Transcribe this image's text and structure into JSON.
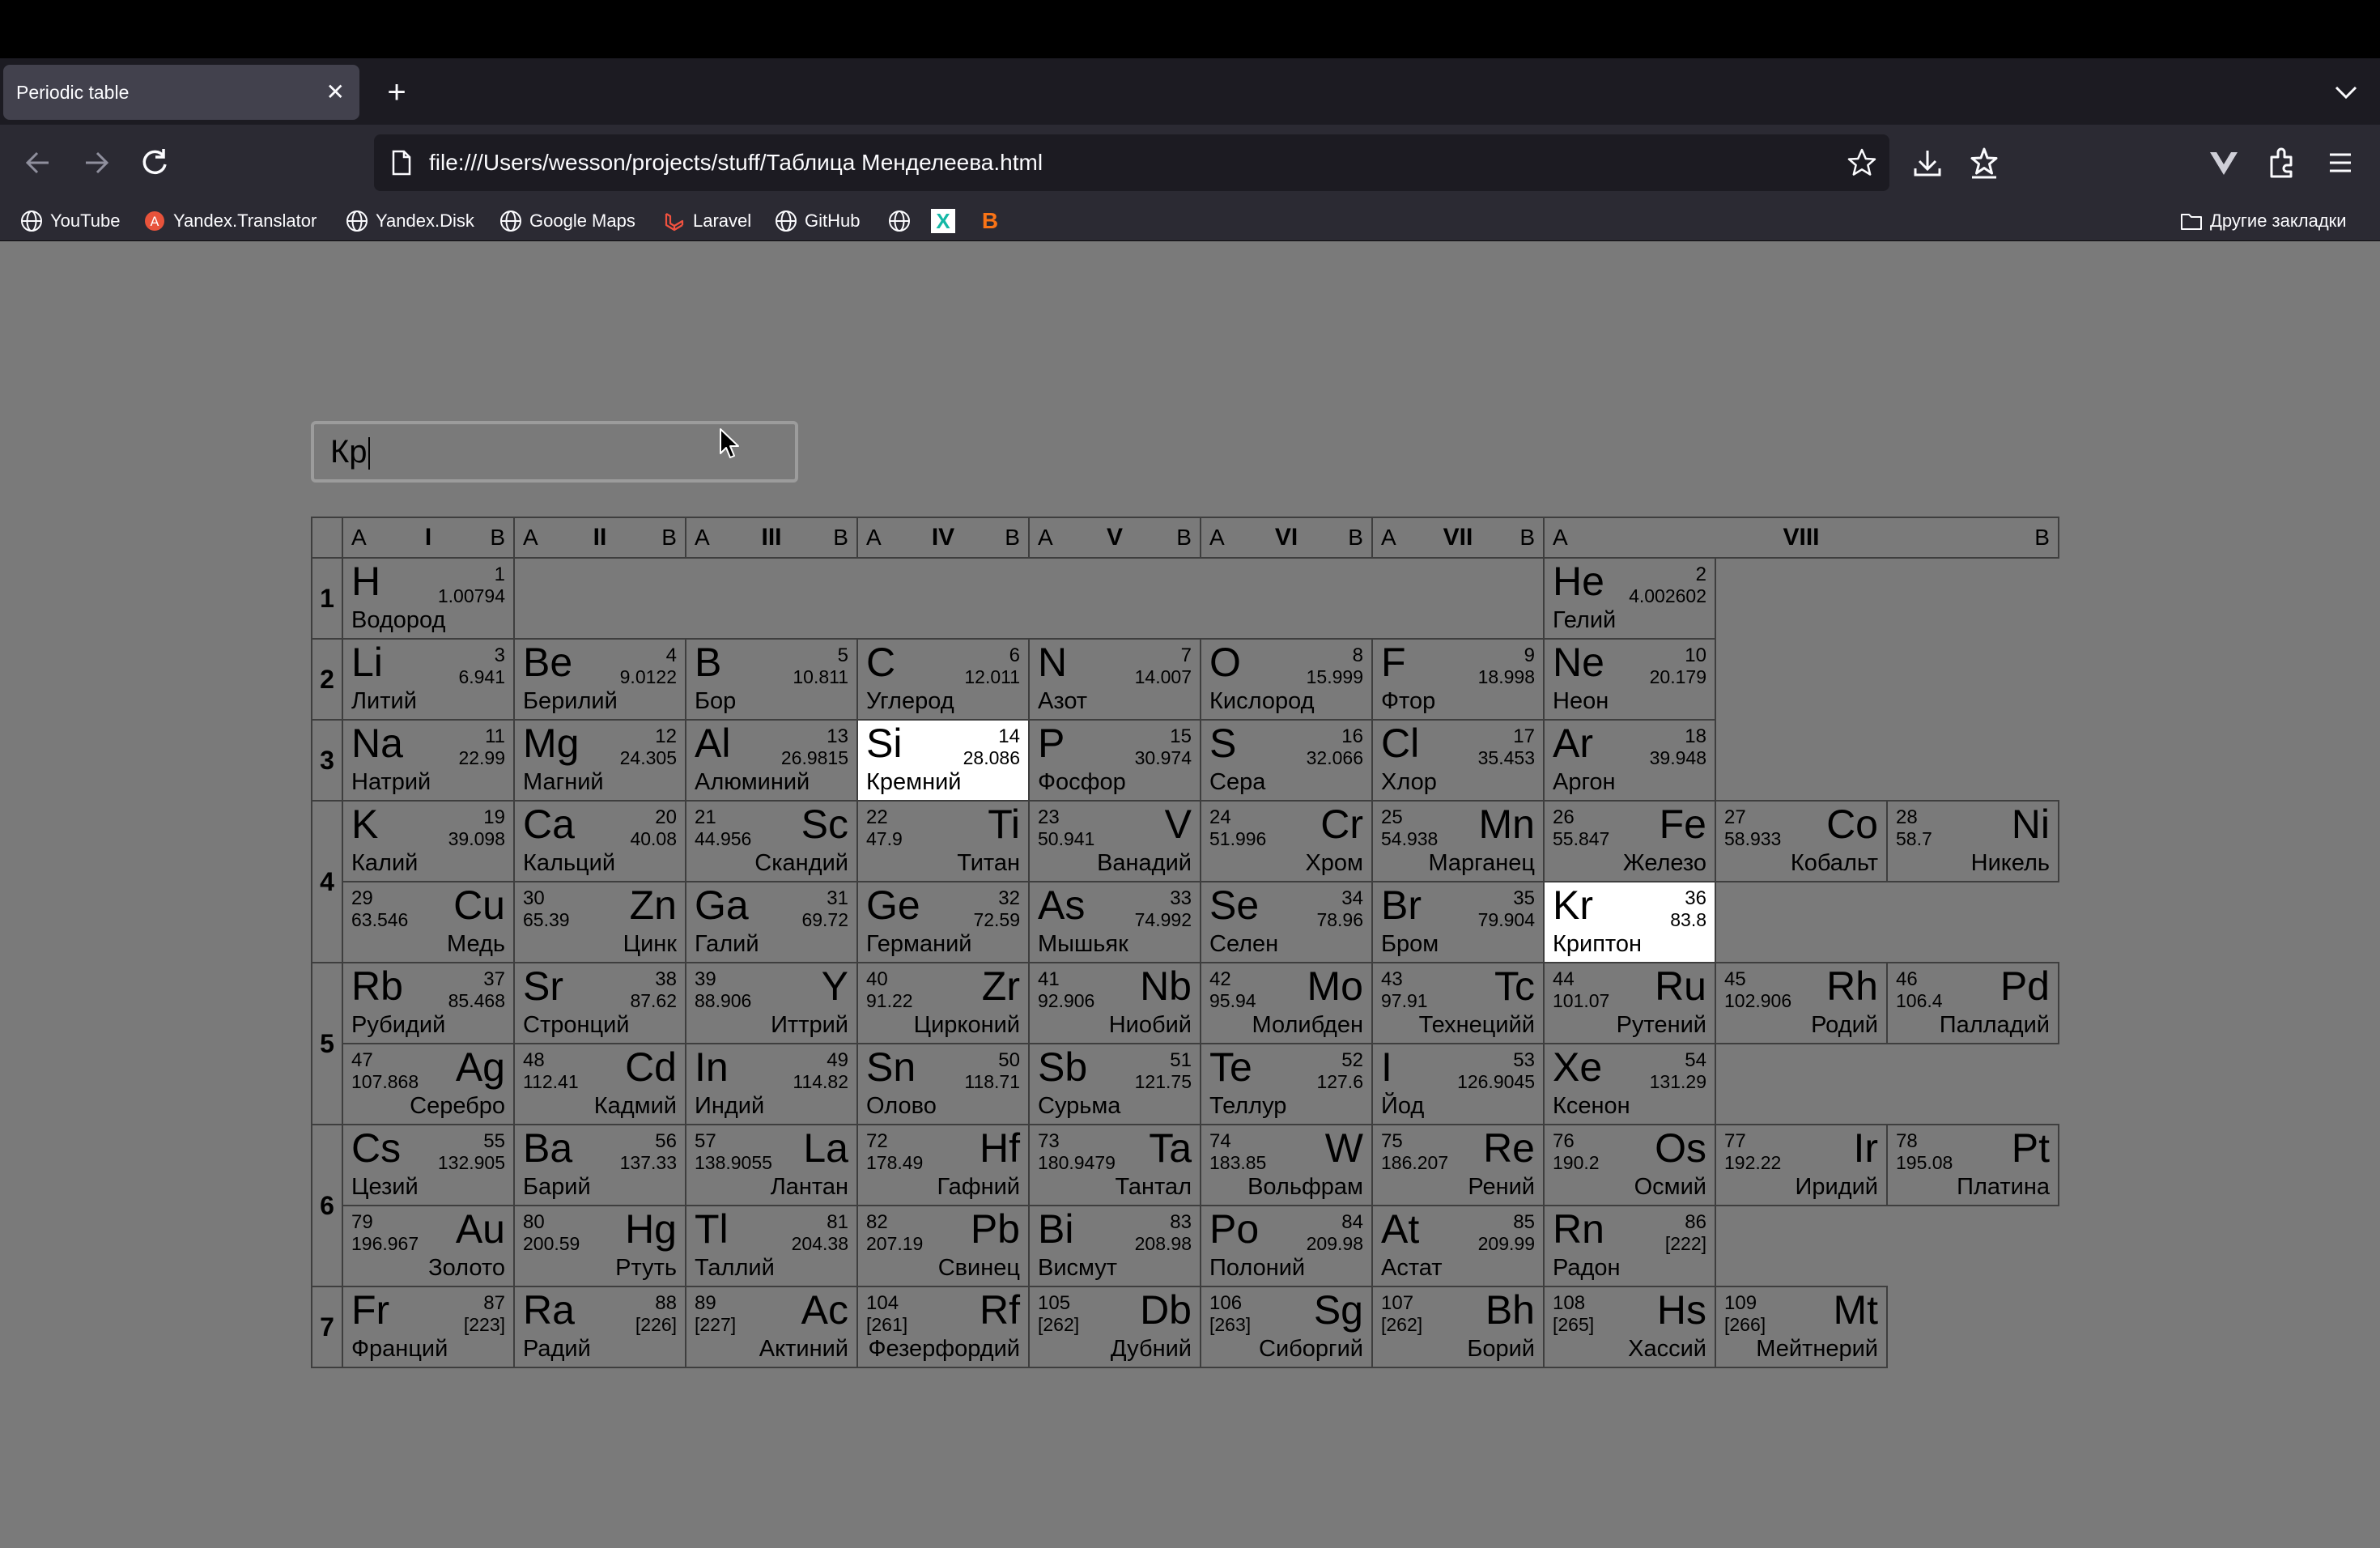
{
  "browser": {
    "tab_title": "Periodic table",
    "url": "file:///Users/wesson/projects/stuff/Таблица Менделеева.html",
    "bookmarks": [
      "YouTube",
      "Yandex.Translator",
      "Yandex.Disk",
      "Google Maps",
      "Laravel",
      "GitHub",
      "",
      "X",
      "B"
    ],
    "other_bookmarks": "Другие закладки"
  },
  "search": {
    "value": "Кр"
  },
  "groups": [
    {
      "a": "A",
      "n": "I",
      "b": "B"
    },
    {
      "a": "A",
      "n": "II",
      "b": "B"
    },
    {
      "a": "A",
      "n": "III",
      "b": "B"
    },
    {
      "a": "A",
      "n": "IV",
      "b": "B"
    },
    {
      "a": "A",
      "n": "V",
      "b": "B"
    },
    {
      "a": "A",
      "n": "VI",
      "b": "B"
    },
    {
      "a": "A",
      "n": "VII",
      "b": "B"
    },
    {
      "a": "A",
      "n": "VIII",
      "b": "B"
    }
  ],
  "periods": [
    {
      "label": "1",
      "rows": 1
    },
    {
      "label": "2",
      "rows": 1
    },
    {
      "label": "3",
      "rows": 1
    },
    {
      "label": "4",
      "rows": 2
    },
    {
      "label": "5",
      "rows": 2
    },
    {
      "label": "6",
      "rows": 2
    },
    {
      "label": "7",
      "rows": 1
    }
  ],
  "rows": [
    [
      [
        "H",
        "1",
        "1.00794",
        "Водород",
        "L"
      ],
      null,
      null,
      null,
      null,
      null,
      null,
      [
        "He",
        "2",
        "4.002602",
        "Гелий",
        "L"
      ]
    ],
    [
      [
        "Li",
        "3",
        "6.941",
        "Литий",
        "L"
      ],
      [
        "Be",
        "4",
        "9.0122",
        "Берилий",
        "L"
      ],
      [
        "B",
        "5",
        "10.811",
        "Бор",
        "L"
      ],
      [
        "C",
        "6",
        "12.011",
        "Углерод",
        "L"
      ],
      [
        "N",
        "7",
        "14.007",
        "Азот",
        "L"
      ],
      [
        "O",
        "8",
        "15.999",
        "Кислород",
        "L"
      ],
      [
        "F",
        "9",
        "18.998",
        "Фтор",
        "L"
      ],
      [
        "Ne",
        "10",
        "20.179",
        "Неон",
        "L"
      ]
    ],
    [
      [
        "Na",
        "11",
        "22.99",
        "Натрий",
        "L"
      ],
      [
        "Mg",
        "12",
        "24.305",
        "Магний",
        "L"
      ],
      [
        "Al",
        "13",
        "26.9815",
        "Алюминий",
        "L"
      ],
      [
        "Si",
        "14",
        "28.086",
        "Кремний",
        "L",
        true
      ],
      [
        "P",
        "15",
        "30.974",
        "Фосфор",
        "L"
      ],
      [
        "S",
        "16",
        "32.066",
        "Сера",
        "L"
      ],
      [
        "Cl",
        "17",
        "35.453",
        "Хлор",
        "L"
      ],
      [
        "Ar",
        "18",
        "39.948",
        "Аргон",
        "L"
      ]
    ],
    [
      [
        "K",
        "19",
        "39.098",
        "Калий",
        "L"
      ],
      [
        "Ca",
        "20",
        "40.08",
        "Кальций",
        "L"
      ],
      [
        "Sc",
        "21",
        "44.956",
        "Скандий",
        "R"
      ],
      [
        "Ti",
        "22",
        "47.9",
        "Титан",
        "R"
      ],
      [
        "V",
        "23",
        "50.941",
        "Ванадий",
        "R"
      ],
      [
        "Cr",
        "24",
        "51.996",
        "Хром",
        "R"
      ],
      [
        "Mn",
        "25",
        "54.938",
        "Марганец",
        "R"
      ],
      [
        "Fe",
        "26",
        "55.847",
        "Железо",
        "R"
      ],
      [
        "Co",
        "27",
        "58.933",
        "Кобальт",
        "R"
      ],
      [
        "Ni",
        "28",
        "58.7",
        "Никель",
        "R"
      ]
    ],
    [
      [
        "Cu",
        "29",
        "63.546",
        "Медь",
        "R"
      ],
      [
        "Zn",
        "30",
        "65.39",
        "Цинк",
        "R"
      ],
      [
        "Ga",
        "31",
        "69.72",
        "Галий",
        "L"
      ],
      [
        "Ge",
        "32",
        "72.59",
        "Германий",
        "L"
      ],
      [
        "As",
        "33",
        "74.992",
        "Мышьяк",
        "L"
      ],
      [
        "Se",
        "34",
        "78.96",
        "Селен",
        "L"
      ],
      [
        "Br",
        "35",
        "79.904",
        "Бром",
        "L"
      ],
      [
        "Kr",
        "36",
        "83.8",
        "Криптон",
        "L",
        true
      ]
    ],
    [
      [
        "Rb",
        "37",
        "85.468",
        "Рубидий",
        "L"
      ],
      [
        "Sr",
        "38",
        "87.62",
        "Стронций",
        "L"
      ],
      [
        "Y",
        "39",
        "88.906",
        "Иттрий",
        "R"
      ],
      [
        "Zr",
        "40",
        "91.22",
        "Цирконий",
        "R"
      ],
      [
        "Nb",
        "41",
        "92.906",
        "Ниобий",
        "R"
      ],
      [
        "Mo",
        "42",
        "95.94",
        "Молибден",
        "R"
      ],
      [
        "Tc",
        "43",
        "97.91",
        "Технецийй",
        "R"
      ],
      [
        "Ru",
        "44",
        "101.07",
        "Рутений",
        "R"
      ],
      [
        "Rh",
        "45",
        "102.906",
        "Родий",
        "R"
      ],
      [
        "Pd",
        "46",
        "106.4",
        "Палладий",
        "R"
      ]
    ],
    [
      [
        "Ag",
        "47",
        "107.868",
        "Серебро",
        "R"
      ],
      [
        "Cd",
        "48",
        "112.41",
        "Кадмий",
        "R"
      ],
      [
        "In",
        "49",
        "114.82",
        "Индий",
        "L"
      ],
      [
        "Sn",
        "50",
        "118.71",
        "Олово",
        "L"
      ],
      [
        "Sb",
        "51",
        "121.75",
        "Сурьма",
        "L"
      ],
      [
        "Te",
        "52",
        "127.6",
        "Теллур",
        "L"
      ],
      [
        "I",
        "53",
        "126.9045",
        "Йод",
        "L"
      ],
      [
        "Xe",
        "54",
        "131.29",
        "Ксенон",
        "L"
      ]
    ],
    [
      [
        "Cs",
        "55",
        "132.905",
        "Цезий",
        "L"
      ],
      [
        "Ba",
        "56",
        "137.33",
        "Барий",
        "L"
      ],
      [
        "La",
        "57",
        "138.9055",
        "Лантан",
        "R"
      ],
      [
        "Hf",
        "72",
        "178.49",
        "Гафний",
        "R"
      ],
      [
        "Ta",
        "73",
        "180.9479",
        "Тантал",
        "R"
      ],
      [
        "W",
        "74",
        "183.85",
        "Вольфрам",
        "R"
      ],
      [
        "Re",
        "75",
        "186.207",
        "Рений",
        "R"
      ],
      [
        "Os",
        "76",
        "190.2",
        "Осмий",
        "R"
      ],
      [
        "Ir",
        "77",
        "192.22",
        "Иридий",
        "R"
      ],
      [
        "Pt",
        "78",
        "195.08",
        "Платина",
        "R"
      ]
    ],
    [
      [
        "Au",
        "79",
        "196.967",
        "Золото",
        "R"
      ],
      [
        "Hg",
        "80",
        "200.59",
        "Ртуть",
        "R"
      ],
      [
        "Tl",
        "81",
        "204.38",
        "Таллий",
        "L"
      ],
      [
        "Pb",
        "82",
        "207.19",
        "Свинец",
        "R"
      ],
      [
        "Bi",
        "83",
        "208.98",
        "Висмут",
        "L"
      ],
      [
        "Po",
        "84",
        "209.98",
        "Полоний",
        "L"
      ],
      [
        "At",
        "85",
        "209.99",
        "Астат",
        "L"
      ],
      [
        "Rn",
        "86",
        "[222]",
        "Радон",
        "L"
      ]
    ],
    [
      [
        "Fr",
        "87",
        "[223]",
        "Франций",
        "L"
      ],
      [
        "Ra",
        "88",
        "[226]",
        "Радий",
        "L"
      ],
      [
        "Ac",
        "89",
        "[227]",
        "Актиний",
        "R"
      ],
      [
        "Rf",
        "104",
        "[261]",
        "Фезерфордий",
        "R"
      ],
      [
        "Db",
        "105",
        "[262]",
        "Дубний",
        "R"
      ],
      [
        "Sg",
        "106",
        "[263]",
        "Сиборгий",
        "R"
      ],
      [
        "Bh",
        "107",
        "[262]",
        "Борий",
        "R"
      ],
      [
        "Hs",
        "108",
        "[265]",
        "Хассий",
        "R"
      ],
      [
        "Mt",
        "109",
        "[266]",
        "Мейтнерий",
        "R"
      ]
    ]
  ]
}
